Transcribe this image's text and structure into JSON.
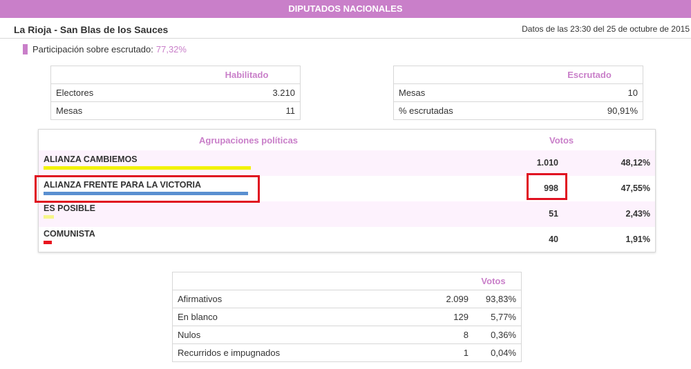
{
  "header": {
    "title": "DIPUTADOS NACIONALES"
  },
  "location": "La Rioja - San Blas de los Sauces",
  "timestamp": "Datos de las 23:30 del 25 de octubre de 2015",
  "participation": {
    "label": "Participación sobre escrutado:",
    "value": "77,32%"
  },
  "habilitado": {
    "header": "Habilitado",
    "rows": [
      {
        "label": "Electores",
        "value": "3.210"
      },
      {
        "label": "Mesas",
        "value": "11"
      }
    ]
  },
  "escrutado": {
    "header": "Escrutado",
    "rows": [
      {
        "label": "Mesas",
        "value": "10"
      },
      {
        "label": "% escrutadas",
        "value": "90,91%"
      }
    ]
  },
  "parties": {
    "header_group": "Agrupaciones políticas",
    "header_votes": "Votos",
    "rows": [
      {
        "name": "ALIANZA CAMBIEMOS",
        "votes": "1.010",
        "pct": "48,12%",
        "share": 48.12,
        "color": "#f2f200"
      },
      {
        "name": "ALIANZA FRENTE PARA LA VICTORIA",
        "votes": "998",
        "pct": "47,55%",
        "share": 47.55,
        "color": "#5a8fd0"
      },
      {
        "name": "ES POSIBLE",
        "votes": "51",
        "pct": "2,43%",
        "share": 2.43,
        "color": "#f6f68a"
      },
      {
        "name": "COMUNISTA",
        "votes": "40",
        "pct": "1,91%",
        "share": 1.91,
        "color": "#e8141e"
      }
    ]
  },
  "votos": {
    "header": "Votos",
    "rows": [
      {
        "label": "Afirmativos",
        "value": "2.099",
        "pct": "93,83%"
      },
      {
        "label": "En blanco",
        "value": "129",
        "pct": "5,77%"
      },
      {
        "label": "Nulos",
        "value": "8",
        "pct": "0,36%"
      },
      {
        "label": "Recurridos e impugnados",
        "value": "1",
        "pct": "0,04%"
      }
    ]
  }
}
